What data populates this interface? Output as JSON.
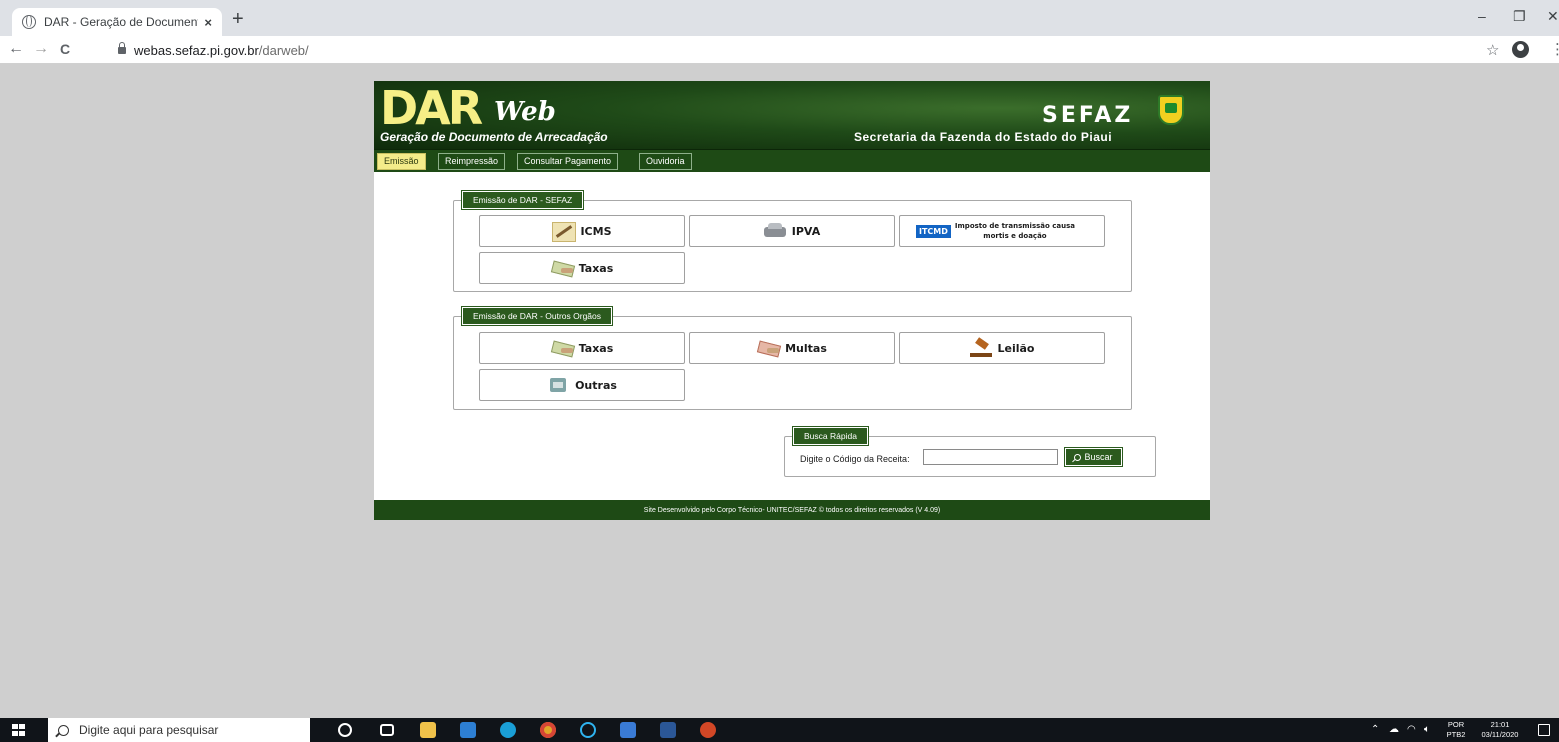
{
  "browser": {
    "tab_title": "DAR - Geração de Documento de",
    "tab_close": "×",
    "new_tab": "+",
    "url_host": "webas.sefaz.pi.gov.br",
    "url_path": "/darweb/",
    "win_minimize": "–",
    "win_restore": "❐",
    "win_close": "✕",
    "back": "←",
    "forward": "→",
    "reload": "C",
    "star": "☆",
    "menu": "⋮"
  },
  "header": {
    "logo_main": "DAR",
    "logo_web": "Web",
    "subtitle": "Geração de Documento de Arrecadação",
    "brand": "SEFAZ",
    "brand_sub": "Secretaria da Fazenda do Estado do Piaui"
  },
  "nav": {
    "items": [
      {
        "label": "Emissão",
        "active": true
      },
      {
        "label": "Reimpressão"
      },
      {
        "label": "Consultar Pagamento"
      },
      {
        "label": "Ouvidoria"
      }
    ]
  },
  "sefaz_group": {
    "legend": "Emissão de DAR - SEFAZ",
    "icms": "ICMS",
    "ipva": "IPVA",
    "itcmd_badge": "ITCMD",
    "itcmd_line1": "Imposto de transmissão causa",
    "itcmd_line2": "mortis e doação",
    "taxas": "Taxas"
  },
  "outros_group": {
    "legend": "Emissão de DAR - Outros Orgãos",
    "taxas": "Taxas",
    "multas": "Multas",
    "leilao": "Leilão",
    "outras": "Outras"
  },
  "busca": {
    "legend": "Busca Rápida",
    "label": "Digite o Código da Receita:",
    "value": "",
    "button": "Buscar"
  },
  "footer": {
    "text": "Site Desenvolvido pelo Corpo Técnico- UNITEC/SEFAZ © todos os direitos reservados (V 4.09)"
  },
  "taskbar": {
    "search_placeholder": "Digite aqui para pesquisar",
    "lang_top": "POR",
    "lang_bottom": "PTB2",
    "time": "21:01",
    "date": "03/11/2020"
  },
  "colors": {
    "header_green": "#1f4a18",
    "nav_green": "#1e4a15",
    "active_tab": "#f4ec8a",
    "logo_yellow": "#f6ef86",
    "itcmd_blue": "#1264c4"
  }
}
